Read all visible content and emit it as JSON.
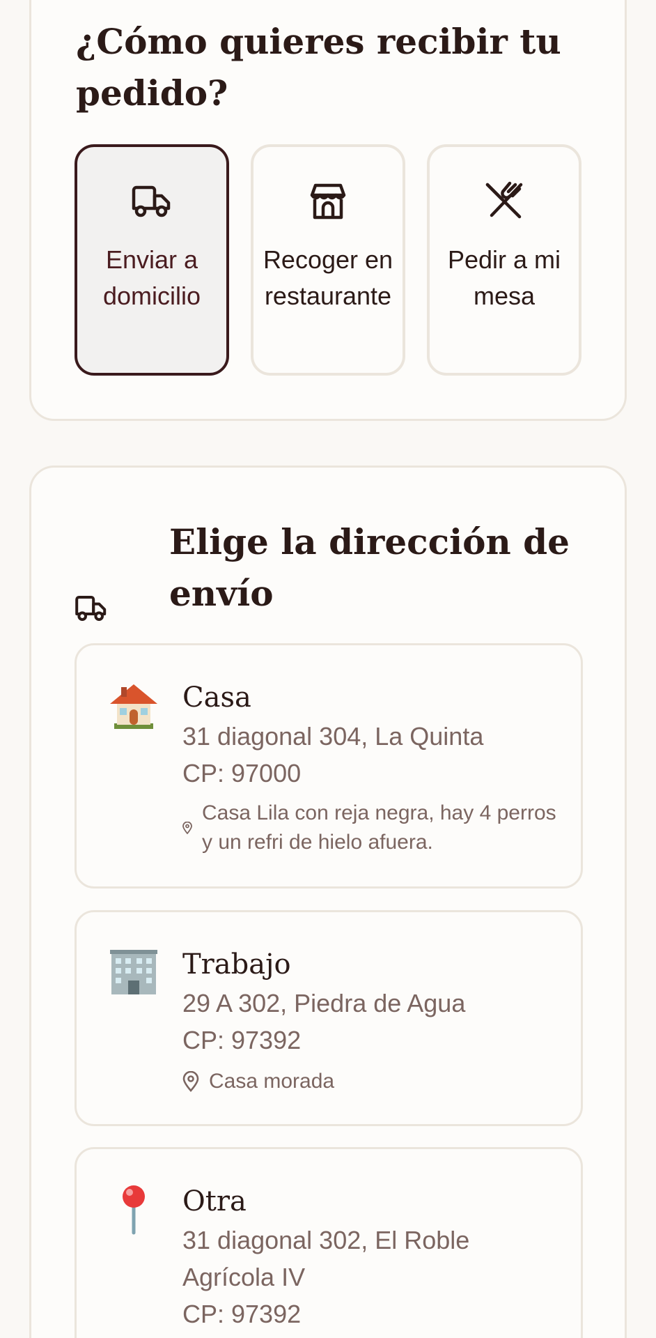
{
  "delivery": {
    "title": "¿Cómo quieres recibir tu pedido?",
    "options": [
      {
        "label": "Enviar a domicilio",
        "icon": "truck-icon",
        "selected": true
      },
      {
        "label": "Recoger en restaurante",
        "icon": "store-icon",
        "selected": false
      },
      {
        "label": "Pedir a mi mesa",
        "icon": "utensils-icon",
        "selected": false
      }
    ]
  },
  "address": {
    "title": "Elige la dirección de envío",
    "items": [
      {
        "name": "Casa",
        "street": "31 diagonal 304, La Quinta",
        "cp": "CP: 97000",
        "note": "Casa Lila con reja negra, hay 4 perros y un refri de hielo afuera.",
        "icon": "house-emoji"
      },
      {
        "name": "Trabajo",
        "street": "29 A 302, Piedra de Agua",
        "cp": "CP: 97392",
        "note": "Casa morada",
        "icon": "office-building-emoji"
      },
      {
        "name": "Otra",
        "street": "31 diagonal 302, El Roble Agrícola IV",
        "cp": "CP: 97392",
        "icon": "round-pushpin-emoji"
      }
    ]
  },
  "colors": {
    "background": "#faf8f5",
    "card_border": "#ebe5dc",
    "selected_border": "#3a1a1c",
    "text_primary": "#2b1a17",
    "text_secondary": "#7b6560"
  }
}
